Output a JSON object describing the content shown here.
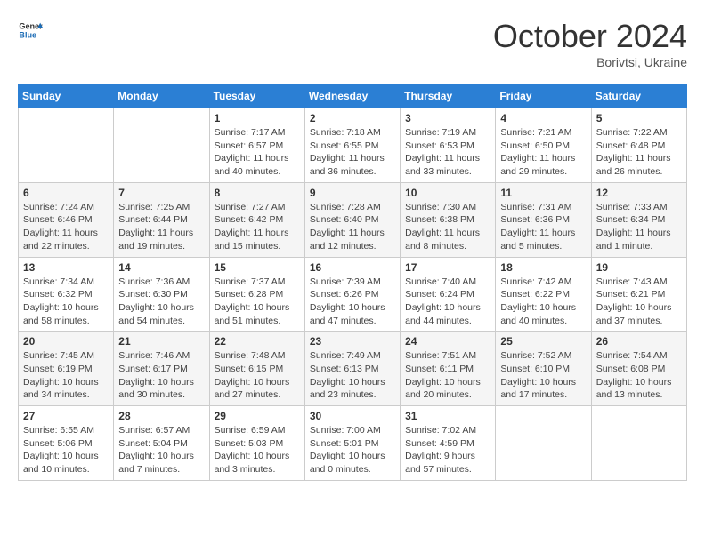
{
  "header": {
    "logo_general": "General",
    "logo_blue": "Blue",
    "month_year": "October 2024",
    "location": "Borivtsi, Ukraine"
  },
  "days_of_week": [
    "Sunday",
    "Monday",
    "Tuesday",
    "Wednesday",
    "Thursday",
    "Friday",
    "Saturday"
  ],
  "weeks": [
    [
      {
        "day": "",
        "detail": ""
      },
      {
        "day": "",
        "detail": ""
      },
      {
        "day": "1",
        "detail": "Sunrise: 7:17 AM\nSunset: 6:57 PM\nDaylight: 11 hours and 40 minutes."
      },
      {
        "day": "2",
        "detail": "Sunrise: 7:18 AM\nSunset: 6:55 PM\nDaylight: 11 hours and 36 minutes."
      },
      {
        "day": "3",
        "detail": "Sunrise: 7:19 AM\nSunset: 6:53 PM\nDaylight: 11 hours and 33 minutes."
      },
      {
        "day": "4",
        "detail": "Sunrise: 7:21 AM\nSunset: 6:50 PM\nDaylight: 11 hours and 29 minutes."
      },
      {
        "day": "5",
        "detail": "Sunrise: 7:22 AM\nSunset: 6:48 PM\nDaylight: 11 hours and 26 minutes."
      }
    ],
    [
      {
        "day": "6",
        "detail": "Sunrise: 7:24 AM\nSunset: 6:46 PM\nDaylight: 11 hours and 22 minutes."
      },
      {
        "day": "7",
        "detail": "Sunrise: 7:25 AM\nSunset: 6:44 PM\nDaylight: 11 hours and 19 minutes."
      },
      {
        "day": "8",
        "detail": "Sunrise: 7:27 AM\nSunset: 6:42 PM\nDaylight: 11 hours and 15 minutes."
      },
      {
        "day": "9",
        "detail": "Sunrise: 7:28 AM\nSunset: 6:40 PM\nDaylight: 11 hours and 12 minutes."
      },
      {
        "day": "10",
        "detail": "Sunrise: 7:30 AM\nSunset: 6:38 PM\nDaylight: 11 hours and 8 minutes."
      },
      {
        "day": "11",
        "detail": "Sunrise: 7:31 AM\nSunset: 6:36 PM\nDaylight: 11 hours and 5 minutes."
      },
      {
        "day": "12",
        "detail": "Sunrise: 7:33 AM\nSunset: 6:34 PM\nDaylight: 11 hours and 1 minute."
      }
    ],
    [
      {
        "day": "13",
        "detail": "Sunrise: 7:34 AM\nSunset: 6:32 PM\nDaylight: 10 hours and 58 minutes."
      },
      {
        "day": "14",
        "detail": "Sunrise: 7:36 AM\nSunset: 6:30 PM\nDaylight: 10 hours and 54 minutes."
      },
      {
        "day": "15",
        "detail": "Sunrise: 7:37 AM\nSunset: 6:28 PM\nDaylight: 10 hours and 51 minutes."
      },
      {
        "day": "16",
        "detail": "Sunrise: 7:39 AM\nSunset: 6:26 PM\nDaylight: 10 hours and 47 minutes."
      },
      {
        "day": "17",
        "detail": "Sunrise: 7:40 AM\nSunset: 6:24 PM\nDaylight: 10 hours and 44 minutes."
      },
      {
        "day": "18",
        "detail": "Sunrise: 7:42 AM\nSunset: 6:22 PM\nDaylight: 10 hours and 40 minutes."
      },
      {
        "day": "19",
        "detail": "Sunrise: 7:43 AM\nSunset: 6:21 PM\nDaylight: 10 hours and 37 minutes."
      }
    ],
    [
      {
        "day": "20",
        "detail": "Sunrise: 7:45 AM\nSunset: 6:19 PM\nDaylight: 10 hours and 34 minutes."
      },
      {
        "day": "21",
        "detail": "Sunrise: 7:46 AM\nSunset: 6:17 PM\nDaylight: 10 hours and 30 minutes."
      },
      {
        "day": "22",
        "detail": "Sunrise: 7:48 AM\nSunset: 6:15 PM\nDaylight: 10 hours and 27 minutes."
      },
      {
        "day": "23",
        "detail": "Sunrise: 7:49 AM\nSunset: 6:13 PM\nDaylight: 10 hours and 23 minutes."
      },
      {
        "day": "24",
        "detail": "Sunrise: 7:51 AM\nSunset: 6:11 PM\nDaylight: 10 hours and 20 minutes."
      },
      {
        "day": "25",
        "detail": "Sunrise: 7:52 AM\nSunset: 6:10 PM\nDaylight: 10 hours and 17 minutes."
      },
      {
        "day": "26",
        "detail": "Sunrise: 7:54 AM\nSunset: 6:08 PM\nDaylight: 10 hours and 13 minutes."
      }
    ],
    [
      {
        "day": "27",
        "detail": "Sunrise: 6:55 AM\nSunset: 5:06 PM\nDaylight: 10 hours and 10 minutes."
      },
      {
        "day": "28",
        "detail": "Sunrise: 6:57 AM\nSunset: 5:04 PM\nDaylight: 10 hours and 7 minutes."
      },
      {
        "day": "29",
        "detail": "Sunrise: 6:59 AM\nSunset: 5:03 PM\nDaylight: 10 hours and 3 minutes."
      },
      {
        "day": "30",
        "detail": "Sunrise: 7:00 AM\nSunset: 5:01 PM\nDaylight: 10 hours and 0 minutes."
      },
      {
        "day": "31",
        "detail": "Sunrise: 7:02 AM\nSunset: 4:59 PM\nDaylight: 9 hours and 57 minutes."
      },
      {
        "day": "",
        "detail": ""
      },
      {
        "day": "",
        "detail": ""
      }
    ]
  ]
}
